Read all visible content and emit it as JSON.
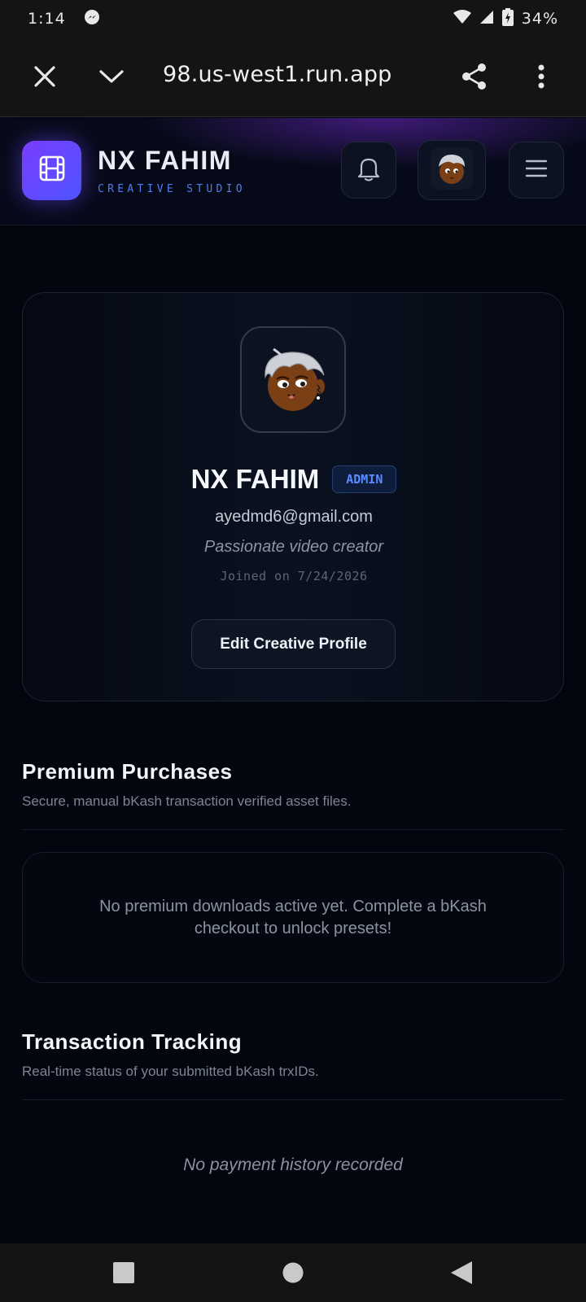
{
  "status_bar": {
    "time": "1:14",
    "battery": "34%"
  },
  "browser": {
    "url": "98.us-west1.run.app"
  },
  "header": {
    "brand_title": "NX FAHIM",
    "brand_subtitle": "CREATIVE STUDIO"
  },
  "profile": {
    "name": "NX FAHIM",
    "role_badge": "ADMIN",
    "email": "ayedmd6@gmail.com",
    "bio": "Passionate video creator",
    "joined": "Joined on 7/24/2026",
    "edit_label": "Edit Creative Profile"
  },
  "purchases": {
    "title": "Premium Purchases",
    "subtitle": "Secure, manual bKash transaction verified asset files.",
    "empty_text": "No premium downloads active yet. Complete a bKash checkout to unlock presets!"
  },
  "transactions": {
    "title": "Transaction Tracking",
    "subtitle": "Real-time status of your submitted bKash trxIDs.",
    "empty_text": "No payment history recorded"
  },
  "colors": {
    "accent": "#4f7df0",
    "logo_gradient_start": "#7a3cff",
    "logo_gradient_end": "#4d55ff",
    "background": "#03060f"
  },
  "icons": [
    "messenger-icon",
    "wifi-icon",
    "signal-icon",
    "battery-icon",
    "close-icon",
    "chevron-down-icon",
    "share-icon",
    "more-vert-icon",
    "film-icon",
    "bell-icon",
    "avatar",
    "menu-icon",
    "nav-recents-icon",
    "nav-home-icon",
    "nav-back-icon"
  ]
}
